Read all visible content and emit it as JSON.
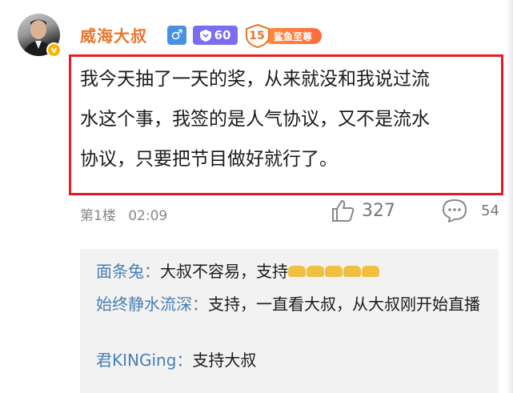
{
  "comment": {
    "username": "威海大叔",
    "verified_badge": "v",
    "gender_icon": "♂",
    "level": "60",
    "fan_badge": {
      "level": "15",
      "label": "鲨鱼至尊"
    },
    "text_lines": [
      "我今天抽了一天的奖，从来就没和我说过流",
      "水这个事，我签的是人气协议，又不是流水",
      "协议，只要把节目做好就行了。"
    ],
    "floor": "第1楼",
    "time": "02:09",
    "likes": "327",
    "replies_count": "54"
  },
  "replies": [
    {
      "name": "面条兔：",
      "text": "大叔不容易，支持",
      "emoji_count": 5
    },
    {
      "name": "始终静水流深：",
      "text": "支持，一直看大叔，从大叔刚开始直播"
    },
    {
      "name": "君KINGing：",
      "text": "支持大叔"
    }
  ],
  "colors": {
    "username": "#e8762b",
    "reply_name": "#4a7fb5",
    "highlight_border": "#e51c24"
  }
}
